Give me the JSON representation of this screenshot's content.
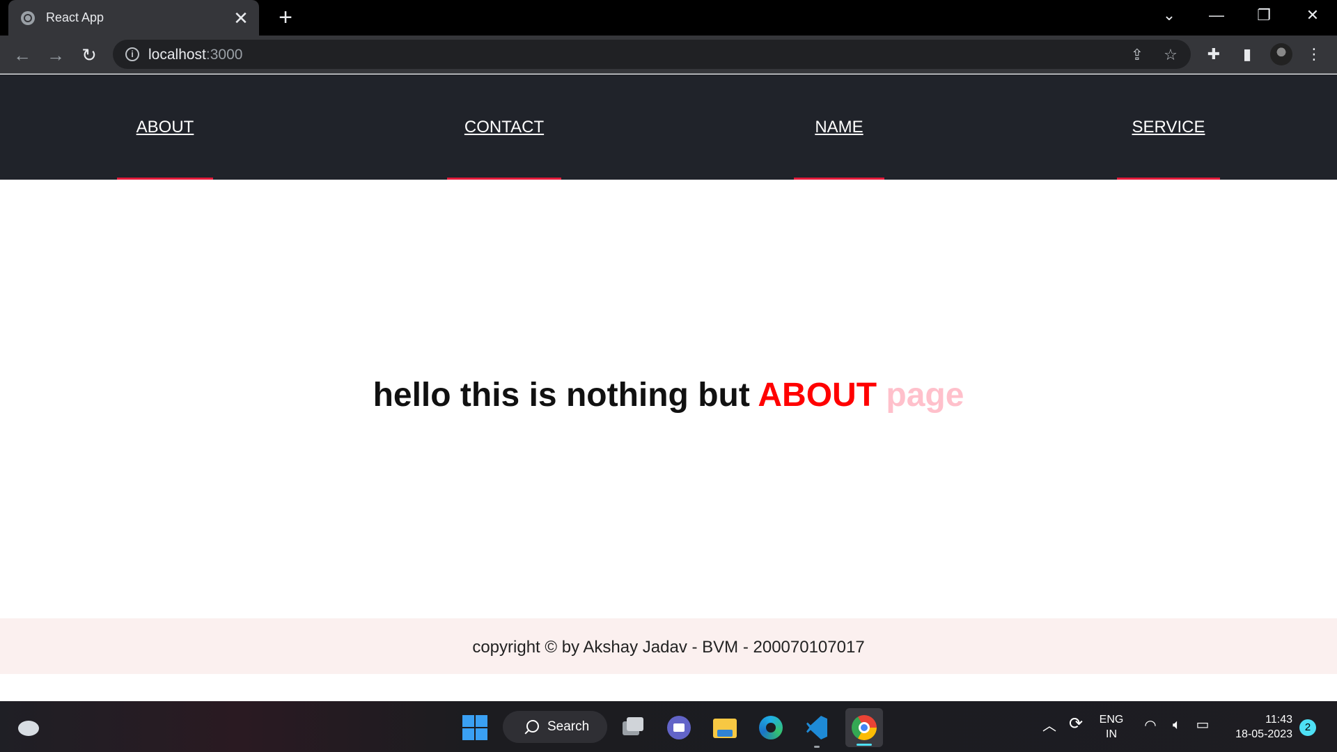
{
  "browser": {
    "tab_title": "React App",
    "tab_close": "✕",
    "new_tab": "+",
    "url_host": "localhost",
    "url_port": ":3000",
    "window_controls": {
      "tablist": "⌄",
      "minimize": "—",
      "restore": "❐",
      "close": "✕"
    },
    "nav": {
      "back": "←",
      "forward": "→",
      "reload": "↻"
    },
    "icons": {
      "share": "⇪",
      "bookmark": "☆",
      "extensions": "✚",
      "side_panel": "▮",
      "menu": "⋮"
    }
  },
  "page": {
    "nav_links": [
      "ABOUT",
      "CONTACT",
      "NAME",
      "SERVICE"
    ],
    "hero": {
      "prefix": "hello this is nothing but ",
      "highlight": "ABOUT",
      "suffix": " page"
    },
    "footer": "copyright © by Akshay Jadav - BVM - 200070107017",
    "colors": {
      "navbar_bg": "#20232a",
      "nav_underline": "#e31b3b",
      "highlight_red": "#ff0000",
      "highlight_pink": "#ffc0cb",
      "footer_bg": "#fbf0ef"
    }
  },
  "taskbar": {
    "search_label": "Search",
    "language": "ENG",
    "region": "IN",
    "time": "11:43",
    "date": "18-05-2023",
    "notification_count": "2",
    "pinned_apps": [
      "task-view",
      "teams-chat",
      "file-explorer",
      "edge",
      "vscode",
      "chrome"
    ]
  }
}
